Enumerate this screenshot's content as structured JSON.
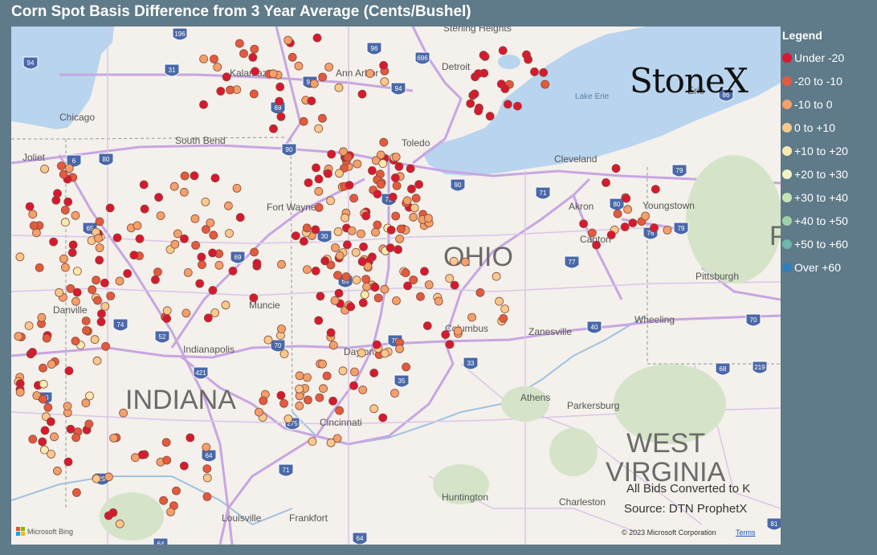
{
  "title": "Corn Spot Basis Difference from 3 Year Average (Cents/Bushel)",
  "legend": {
    "title": "Legend",
    "items": [
      {
        "label": "Under -20",
        "color": "#d8182f"
      },
      {
        "label": "-20 to -10",
        "color": "#e45a3e"
      },
      {
        "label": "-10 to 0",
        "color": "#f4a06a"
      },
      {
        "label": "0 to +10",
        "color": "#f9c98c"
      },
      {
        "label": "+10 to +20",
        "color": "#faeab0"
      },
      {
        "label": "+20 to +30",
        "color": "#f0f3c6"
      },
      {
        "label": "+30 to +40",
        "color": "#c9e4b3"
      },
      {
        "label": "+40 to +50",
        "color": "#9ed1a8"
      },
      {
        "label": "+50 to +60",
        "color": "#6fb7ac"
      },
      {
        "label": "Over +60",
        "color": "#2f7fbf"
      }
    ]
  },
  "brand": "StoneX",
  "notes": {
    "line1": "All Bids Converted to K",
    "line2": "Source: DTN ProphetX"
  },
  "attribution": {
    "copyright": "© 2023 Microsoft Corporation",
    "terms": "Terms",
    "provider": "Microsoft Bing"
  },
  "map": {
    "states": [
      "INDIANA",
      "OHIO",
      "WEST",
      "VIRGINIA"
    ],
    "cities": [
      "Chicago",
      "Joliet",
      "Kalamazoo",
      "Ann Arbor",
      "Detroit",
      "Sterling Heights",
      "South Bend",
      "Toledo",
      "Cleveland",
      "Akron",
      "Youngstown",
      "Canton",
      "Fort Wayne",
      "Pittsburgh",
      "Muncie",
      "Indianapolis",
      "Dayton",
      "Columbus",
      "Zanesville",
      "Wheeling",
      "Cincinnati",
      "Athens",
      "Parkersburg",
      "Louisville",
      "Frankfort",
      "Huntington",
      "Charleston",
      "Lake Erie",
      "Danville",
      "Erie"
    ],
    "highways": [
      "196",
      "94",
      "96",
      "696",
      "31",
      "94",
      "94",
      "69",
      "80",
      "90",
      "6",
      "90",
      "75",
      "79",
      "80",
      "76",
      "79",
      "86",
      "65",
      "69",
      "30",
      "71",
      "77",
      "74",
      "52",
      "421",
      "70",
      "70",
      "40",
      "33",
      "35",
      "70",
      "68",
      "219",
      "275",
      "71",
      "64",
      "64",
      "29",
      "64",
      "81",
      "70",
      "65"
    ]
  }
}
